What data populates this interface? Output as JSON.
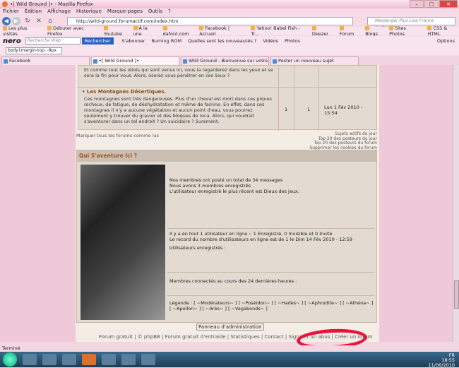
{
  "window": {
    "title": "•[ Wild Ground ]• - Mozilla Firefox"
  },
  "menu": [
    "Fichier",
    "Édition",
    "Affichage",
    "Historique",
    "Marque-pages",
    "Outils",
    "?"
  ],
  "url": "http://wild-ground.forumactif.com/index.htm",
  "search_placeholder": "Messenger Plus Live France Customize",
  "bookmarks": [
    "Les plus visités",
    "Débuter avec Firefox",
    "Youtube",
    "À la une",
    "dafont.com",
    "Facebook | Accueil",
    "Yahoo! Babel Fish - Tr...",
    "Deezer",
    "Forum",
    "Blogs",
    "Sites Photos",
    "CSS & HTML"
  ],
  "nero": {
    "logo": "nero",
    "search_placeholder": "Recherche Web",
    "button": "Rechercher",
    "items": [
      "S'abonner",
      "Burning ROM",
      "Quelles sont les nouveautés ?",
      "Vidéos",
      "Photos"
    ],
    "options": "Options"
  },
  "css_field": "body{margin-top: -9px",
  "tabs": [
    "Facebook",
    "•[ Wild Ground ]•",
    "Wild Ground - Bienvenue sur votre ...",
    "Poster un nouveau sujet"
  ],
  "forum": {
    "row1_text": "Et comme tout les idiots qui sont venus ici, vous la regarderez dans les yeux et se sera la fin pour vous. Alors, oserez vous pénétrer en ces lieux ?",
    "row2_title": "Les Montagnes Désertiques.",
    "row2_text": "Ces montagnes sont très dangereuses. Plus d'un cheval est mort dans ces piques rocheux, de fatigue, de déshydratation et même de famine. En effet, dans ces montagnes il n'y a aucune végétation et aucun point d'eau, vous pourrez seulement y trouver du gravier et des bloques de roca. Alors, qui voudrait s'aventurer dans un tel endroit ? Un suicidaire ? Surement.",
    "row2_topics": "1",
    "row2_posts": "1",
    "row2_last": "Lun 1 Fév 2010 - 15:54"
  },
  "mark_read": "Marquer tous les forums comme lus",
  "links_right": [
    "Sujets actifs du jour",
    "Top 20 des posteurs du jour",
    "Top 20 des posteurs du forum",
    "Supprimer les cookies du forum"
  ],
  "who": {
    "title": "Qui S'aventure Ici ?",
    "stat1": "Nos membres ont posté un total de 34 messages",
    "stat2": "Nous avons 3 membres enregistrés",
    "stat3": "L'utilisateur enregistré le plus récent est Dieux des jeux.",
    "online1": "Il y a en tout 1 utilisateur en ligne :: 1 Enregistré, 0 Invisible et 0 Invité",
    "online2": "Le record du nombre d'utilisateurs en ligne est de 1 le Dim 14 Fév 2010 - 12:59",
    "online3": "Utilisateurs enregistrés :",
    "last24": "Membres connectés au cours des 24 dernières heures :",
    "legend": "Légende : [ ~Modérateurs~ ] [ ~Poséidon~ ] [ ~Hadès~ ] [ ~Aphrodite~ ] [ ~Athéna~ ] [ ~Apollon~ ] [ ~Arès~ ] [ ~Vagabonds~ ]"
  },
  "admin_panel": "Panneau d'administration",
  "footer": "Forum gratuit | © phpBB | Forum gratuit d'entraide | Statistiques | Contact | Signaler un abus | Créer un forum",
  "status": "Terminé",
  "tray": {
    "lang": "FR",
    "time": "18:55",
    "date": "11/06/2010"
  }
}
